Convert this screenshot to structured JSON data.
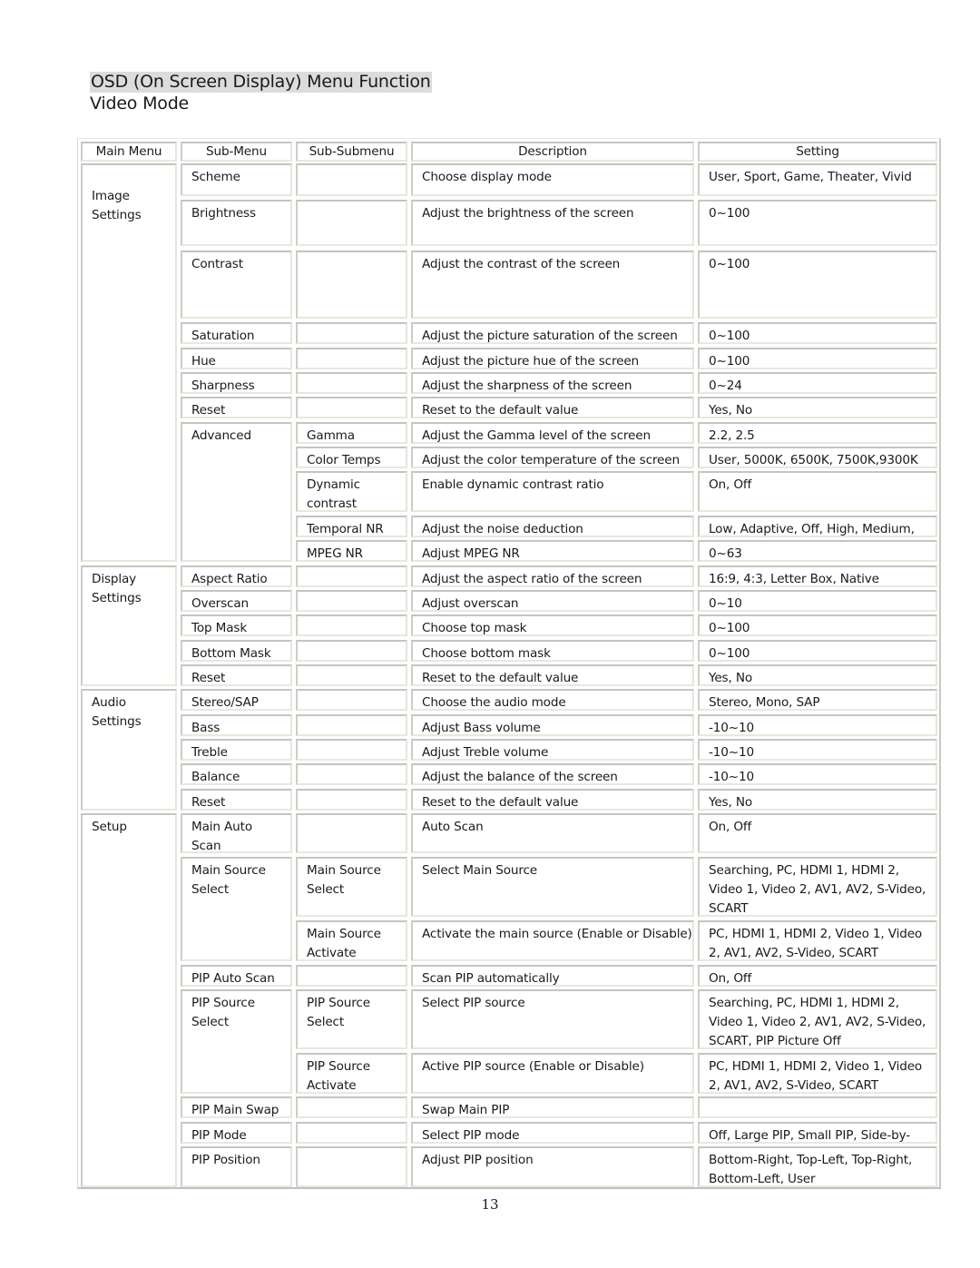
{
  "page": {
    "title": "OSD (On Screen Display) Menu Function",
    "subtitle": "Video Mode",
    "page_number": "13"
  },
  "table": {
    "headers": [
      "Main Menu",
      "Sub-Menu",
      "Sub-Submenu",
      "Description",
      "Setting"
    ],
    "groups": [
      {
        "main": "Image\nSettings"
      },
      {
        "main": "Display\nSettings"
      },
      {
        "main": "Audio\nSettings"
      },
      {
        "main": "Setup"
      }
    ],
    "submenus": [
      "Scheme",
      "Brightness",
      "Contrast",
      "Saturation",
      "Hue",
      "Sharpness",
      "Reset",
      "Advanced",
      "Aspect Ratio",
      "Overscan",
      "Top Mask",
      "Bottom Mask",
      "Reset",
      "Stereo/SAP",
      "Bass",
      "Treble",
      "Balance",
      "Reset",
      "Main Auto\nScan",
      "Main Source\nSelect",
      "PIP Auto Scan",
      "PIP Source\nSelect",
      "PIP Main Swap",
      "PIP Mode",
      "PIP Position"
    ],
    "rows": [
      {
        "subsub": "",
        "desc": "Choose display mode",
        "setting": "User, Sport, Game, Theater, Vivid"
      },
      {
        "subsub": "",
        "desc": "Adjust the brightness of the screen",
        "setting": "0~100"
      },
      {
        "subsub": "",
        "desc": "Adjust the contrast of the screen",
        "setting": "0~100"
      },
      {
        "subsub": "",
        "desc": "Adjust the picture saturation of the screen",
        "setting": "0~100"
      },
      {
        "subsub": "",
        "desc": "Adjust the picture hue of the screen",
        "setting": "0~100"
      },
      {
        "subsub": "",
        "desc": "Adjust the sharpness of the screen",
        "setting": "0~24"
      },
      {
        "subsub": "",
        "desc": "Reset to the default value",
        "setting": "Yes, No"
      },
      {
        "subsub": "Gamma",
        "desc": "Adjust the Gamma level of the screen",
        "setting": "2.2, 2.5"
      },
      {
        "subsub": "Color Temps",
        "desc": "Adjust the color temperature of the screen",
        "setting": "User, 5000K, 6500K, 7500K,9300K"
      },
      {
        "subsub": "Dynamic\ncontrast",
        "desc": "Enable dynamic contrast ratio",
        "setting": "On, Off"
      },
      {
        "subsub": "Temporal NR",
        "desc": "Adjust the noise deduction",
        "setting": "Low, Adaptive, Off, High, Medium,"
      },
      {
        "subsub": "MPEG NR",
        "desc": "Adjust MPEG NR",
        "setting": "0~63"
      },
      {
        "subsub": "",
        "desc": "Adjust the aspect ratio of the screen",
        "setting": "16:9, 4:3, Letter Box, Native"
      },
      {
        "subsub": "",
        "desc": "Adjust overscan",
        "setting": "0~10"
      },
      {
        "subsub": "",
        "desc": "Choose top mask",
        "setting": "0~100"
      },
      {
        "subsub": "",
        "desc": "Choose bottom mask",
        "setting": "0~100"
      },
      {
        "subsub": "",
        "desc": "Reset to the default value",
        "setting": "Yes, No"
      },
      {
        "subsub": "",
        "desc": "Choose the audio mode",
        "setting": "Stereo, Mono, SAP"
      },
      {
        "subsub": "",
        "desc": "Adjust Bass volume",
        "setting": "-10~10"
      },
      {
        "subsub": "",
        "desc": "Adjust Treble volume",
        "setting": "-10~10"
      },
      {
        "subsub": "",
        "desc": "Adjust the balance of the screen",
        "setting": "-10~10"
      },
      {
        "subsub": "",
        "desc": "Reset to the default value",
        "setting": "Yes, No"
      },
      {
        "subsub": "",
        "desc": "Auto Scan",
        "setting": "On, Off"
      },
      {
        "subsub": "Main Source\nSelect",
        "desc": "Select Main Source",
        "setting": "Searching, PC, HDMI 1, HDMI 2,\nVideo 1, Video 2, AV1, AV2, S-Video,\nSCART"
      },
      {
        "subsub": "Main Source\nActivate",
        "desc": "Activate the main source (Enable or Disable)",
        "setting": "PC, HDMI 1, HDMI 2, Video 1, Video\n2, AV1, AV2, S-Video, SCART"
      },
      {
        "subsub": "",
        "desc": "Scan PIP automatically",
        "setting": "On, Off"
      },
      {
        "subsub": "PIP Source\nSelect",
        "desc": "Select PIP source",
        "setting": "Searching, PC, HDMI 1, HDMI 2,\nVideo 1, Video 2, AV1, AV2, S-Video,\nSCART, PIP Picture Off"
      },
      {
        "subsub": "PIP Source\nActivate",
        "desc": "Active PIP source (Enable or Disable)",
        "setting": "PC, HDMI 1, HDMI 2, Video 1, Video\n2, AV1, AV2, S-Video, SCART"
      },
      {
        "subsub": "",
        "desc": "Swap Main PIP",
        "setting": ""
      },
      {
        "subsub": "",
        "desc": "Select PIP mode",
        "setting": "Off, Large PIP, Small PIP, Side-by-Side"
      },
      {
        "subsub": "",
        "desc": "Adjust PIP position",
        "setting": "Bottom-Right, Top-Left, Top-Right,\nBottom-Left, User"
      }
    ]
  }
}
